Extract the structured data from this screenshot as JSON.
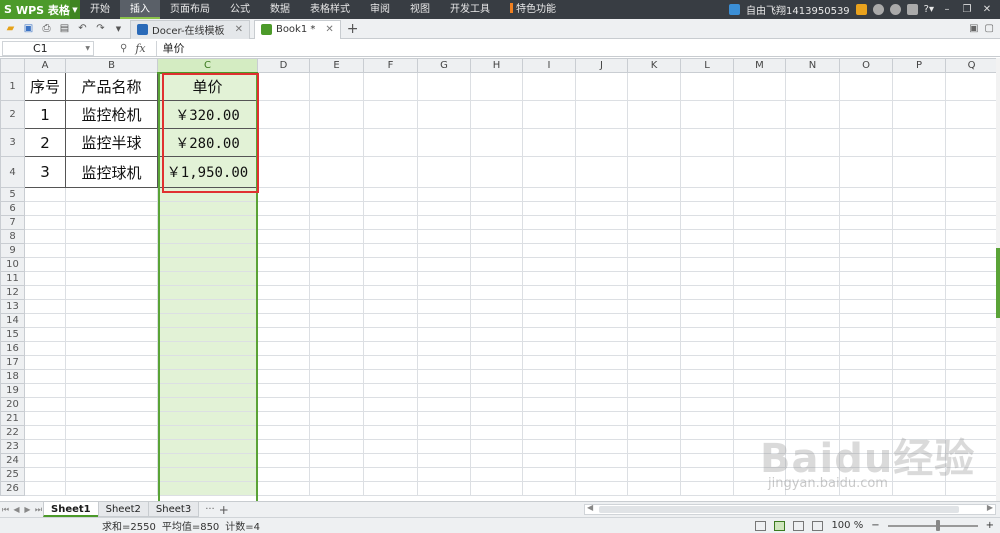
{
  "app": {
    "name": "WPS 表格",
    "logo_letter": "S"
  },
  "menu": {
    "items": [
      "开始",
      "插入",
      "页面布局",
      "公式",
      "数据",
      "表格样式",
      "审阅",
      "视图",
      "开发工具",
      "特色功能"
    ],
    "active": "插入"
  },
  "user": {
    "name": "自由飞翔1413950539"
  },
  "tabs": [
    {
      "label": "Docer-在线模板",
      "active": false
    },
    {
      "label": "Book1 *",
      "active": true
    }
  ],
  "formula_bar": {
    "cell_ref": "C1",
    "fx": "fx",
    "content": "单价"
  },
  "grid": {
    "columns": [
      "A",
      "B",
      "C",
      "D",
      "E",
      "F",
      "G",
      "H",
      "I",
      "J",
      "K",
      "L",
      "M",
      "N",
      "O",
      "P",
      "Q"
    ],
    "selected_column": "C",
    "row_count": 26,
    "table": {
      "header": [
        "序号",
        "产品名称",
        "单价"
      ],
      "rows": [
        [
          "1",
          "监控枪机",
          "￥320.00"
        ],
        [
          "2",
          "监控半球",
          "￥280.00"
        ],
        [
          "3",
          "监控球机",
          "￥1,950.00"
        ]
      ]
    }
  },
  "sheets": {
    "tabs": [
      "Sheet1",
      "Sheet2",
      "Sheet3"
    ],
    "active": "Sheet1",
    "more": "···",
    "add": "+"
  },
  "status": {
    "sum": "求和=2550",
    "avg": "平均值=850",
    "count": "计数=4",
    "zoom": "100 %"
  },
  "watermark": {
    "brand": "Baidu经验",
    "url": "jingyan.baidu.com"
  },
  "colors": {
    "accent_green": "#4c9a2a",
    "highlight_red": "#e03030",
    "menubar_bg": "#383d43"
  }
}
